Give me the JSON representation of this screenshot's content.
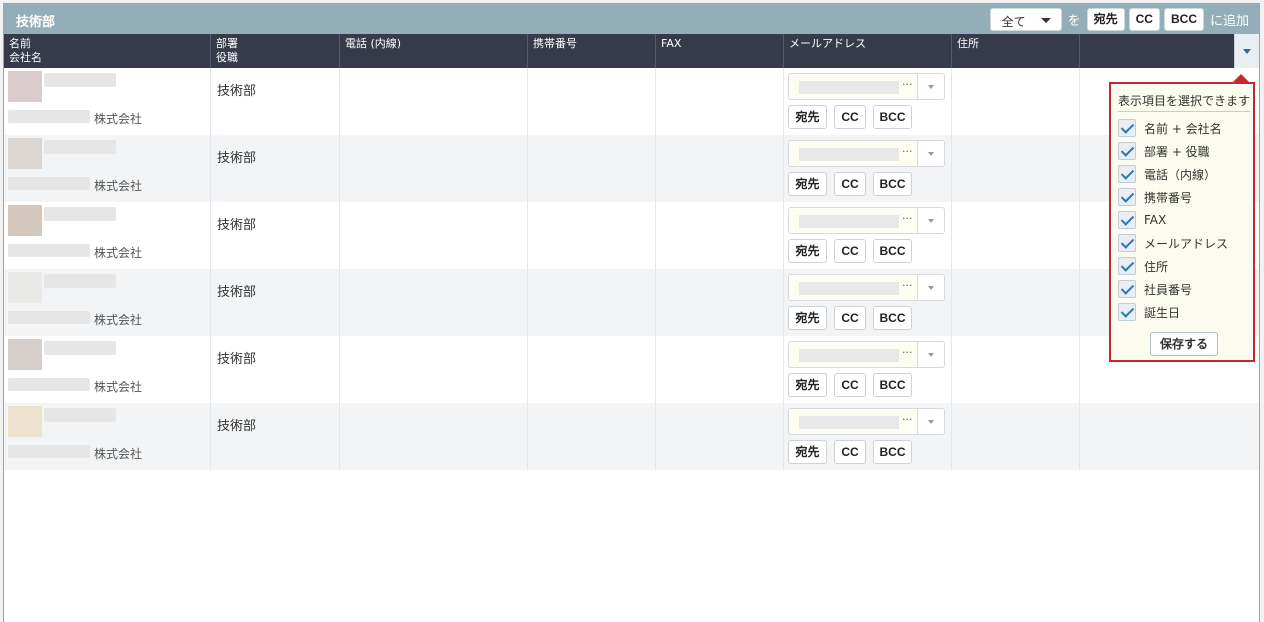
{
  "panel": {
    "title": "技術部"
  },
  "toolbar": {
    "select_value": "全て",
    "wo_text": "を",
    "to_label": "宛先",
    "cc_label": "CC",
    "bcc_label": "BCC",
    "add_text": "に追加"
  },
  "columns": [
    {
      "line1": "名前",
      "line2": "会社名"
    },
    {
      "line1": "部署",
      "line2": "役職"
    },
    {
      "line1": "電話 (内線)",
      "line2": ""
    },
    {
      "line1": "携帯番号",
      "line2": ""
    },
    {
      "line1": "FAX",
      "line2": ""
    },
    {
      "line1": "メールアドレス",
      "line2": ""
    },
    {
      "line1": "住所",
      "line2": ""
    }
  ],
  "rows": [
    {
      "company": "株式会社",
      "department": "技術部",
      "to": "宛先",
      "cc": "CC",
      "bcc": "BCC",
      "dots": "···"
    },
    {
      "company": "株式会社",
      "department": "技術部",
      "to": "宛先",
      "cc": "CC",
      "bcc": "BCC",
      "dots": "···"
    },
    {
      "company": "株式会社",
      "department": "技術部",
      "to": "宛先",
      "cc": "CC",
      "bcc": "BCC",
      "dots": "···"
    },
    {
      "company": "株式会社",
      "department": "技術部",
      "to": "宛先",
      "cc": "CC",
      "bcc": "BCC",
      "dots": "···"
    },
    {
      "company": "株式会社",
      "department": "技術部",
      "to": "宛先",
      "cc": "CC",
      "bcc": "BCC",
      "dots": "···"
    },
    {
      "company": "株式会社",
      "department": "技術部",
      "to": "宛先",
      "cc": "CC",
      "bcc": "BCC",
      "dots": "···"
    }
  ],
  "popup": {
    "title": "表示項目を選択できます",
    "options": [
      {
        "label": "名前 + 会社名",
        "checked": true
      },
      {
        "label": "部署 + 役職",
        "checked": true
      },
      {
        "label": "電話（内線）",
        "checked": true
      },
      {
        "label": "携帯番号",
        "checked": true
      },
      {
        "label": "FAX",
        "checked": true
      },
      {
        "label": "メールアドレス",
        "checked": true
      },
      {
        "label": "住所",
        "checked": true
      },
      {
        "label": "社員番号",
        "checked": true
      },
      {
        "label": "誕生日",
        "checked": true
      }
    ],
    "save_label": "保存する"
  },
  "icons": {
    "select_caret": "caret-down-icon",
    "column_toggle": "caret-down-icon",
    "checkbox": "check-icon"
  },
  "colors": {
    "titlebar": "#94aeb9",
    "header": "#363a4b",
    "popup_border": "#c6282c",
    "check": "#2b78b6"
  }
}
